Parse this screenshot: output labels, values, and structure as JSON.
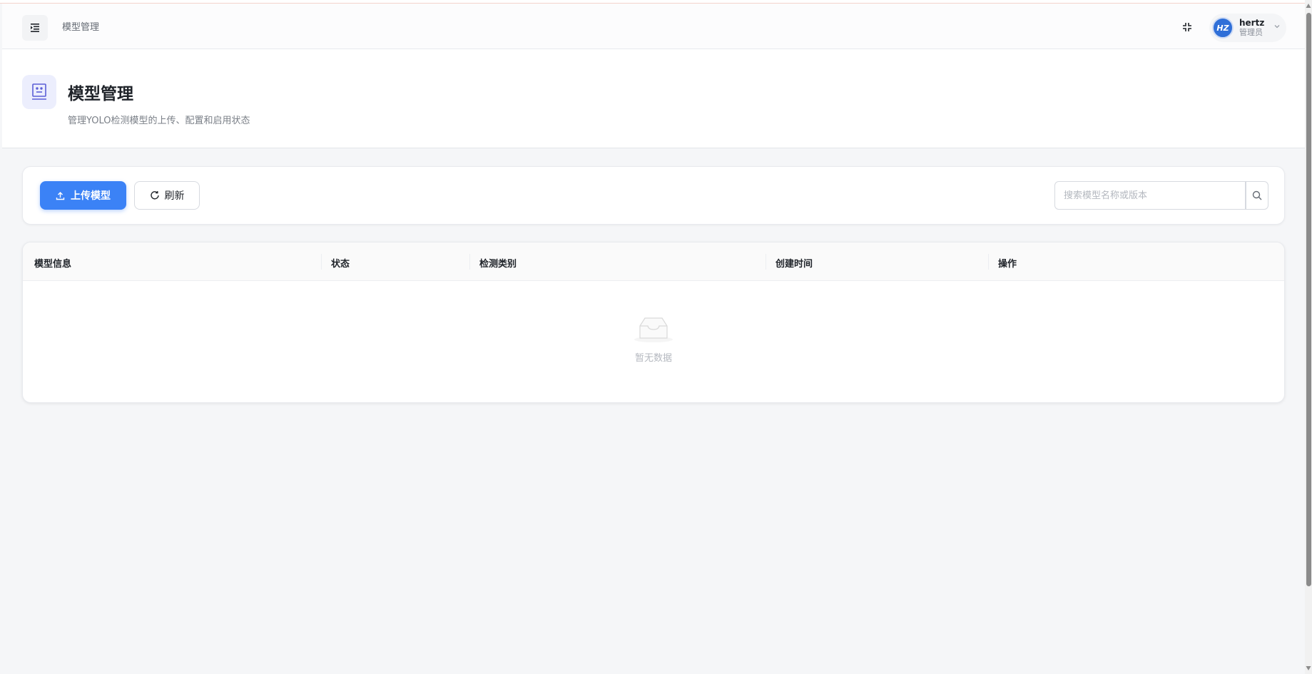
{
  "header": {
    "breadcrumb": "模型管理",
    "user": {
      "avatar_text": "HZ",
      "name": "hertz",
      "role": "管理员"
    },
    "icons": {
      "menu": "menu-fold-icon",
      "fullscreen": "fullscreen-exit-icon",
      "caret": "chevron-down-icon"
    }
  },
  "page": {
    "title": "模型管理",
    "subtitle": "管理YOLO检测模型的上传、配置和启用状态"
  },
  "toolbar": {
    "upload_label": "上传模型",
    "refresh_label": "刷新",
    "search_placeholder": "搜索模型名称或版本"
  },
  "table": {
    "columns": [
      "模型信息",
      "状态",
      "检测类别",
      "创建时间",
      "操作"
    ],
    "empty_text": "暂无数据"
  },
  "colors": {
    "primary": "#3b82f6",
    "accent_icon_bg": "#eceefd",
    "accent_icon": "#5b5fd6"
  }
}
